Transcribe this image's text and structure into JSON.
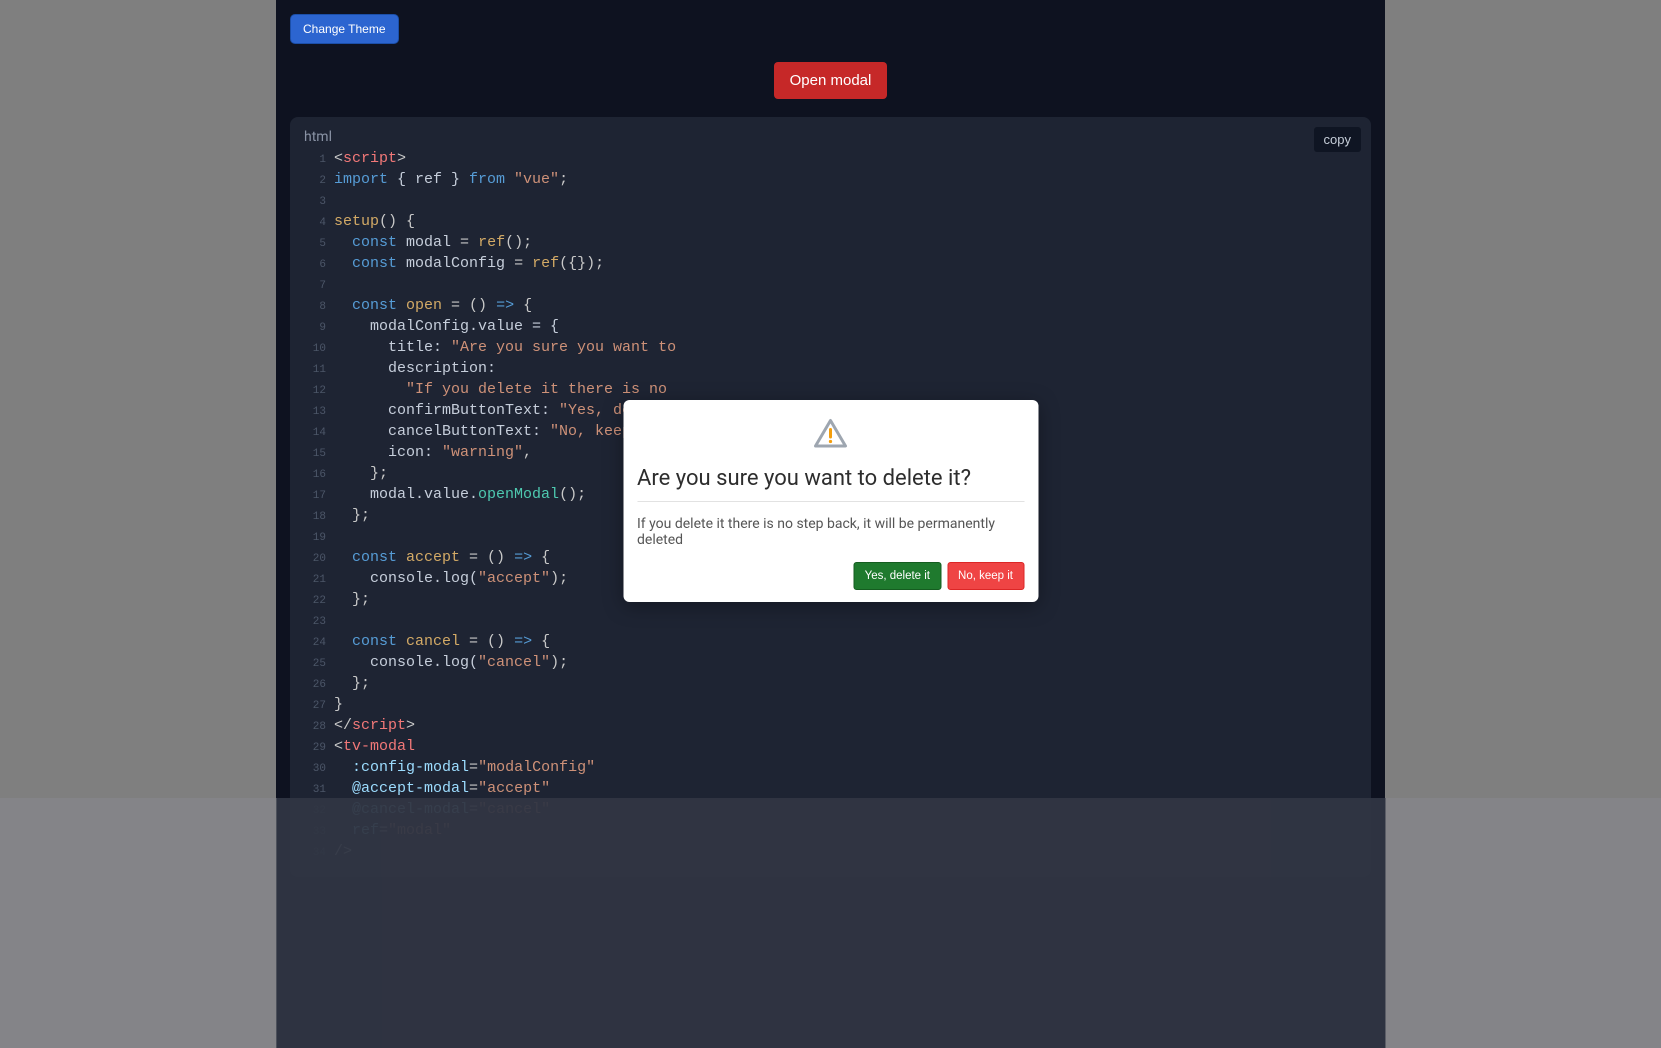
{
  "header": {
    "change_theme": "Change Theme",
    "open_modal": "Open modal"
  },
  "code": {
    "language": "html",
    "copy": "copy"
  },
  "modal": {
    "title": "Are you sure you want to delete it?",
    "description": "If you delete it there is no step back, it will be permanently deleted",
    "confirm": "Yes, delete it",
    "cancel": "No, keep it"
  },
  "snippets": {
    "open_tag_lt": "<",
    "open_tag_gt": ">",
    "close_tag_lt": "</",
    "script": "script",
    "import": "import ",
    "braces_ref": "{ ref } ",
    "from": "from ",
    "vue": "\"vue\"",
    "semi": ";",
    "setup": "setup",
    "paren_brace": "() {",
    "const_sp": "const ",
    "modal": "modal",
    "eq": " = ",
    "ref": "ref",
    "paren_empty": "();",
    "modalConfig": "modalConfig",
    "ref_obj": "({});",
    "open": "open",
    "arrow": " = () ",
    "fat": "=>",
    "brace": " {",
    "mc_val": "modalConfig.value = {",
    "title_k": "title: ",
    "title_v": "\"Are you sure you want to",
    "desc_k": "description:",
    "desc_v": "\"If you delete it there is no",
    "cbt_k": "confirmButtonText: ",
    "cbt_v": "\"Yes, delete",
    "cnt_k": "cancelButtonText: ",
    "cnt_v": "\"No, keep it\"",
    "comma": ",",
    "icon_k": "icon: ",
    "icon_v": "\"warning\"",
    "close_obj": "};",
    "modal_value": "modal.value.",
    "openModal": "openModal",
    "call_empty": "();",
    "accept": "accept",
    "console": "console",
    "dot_log": ".log(",
    "accept_str": "\"accept\"",
    "close_call": ");",
    "cancel": "cancel",
    "cancel_str": "\"cancel\"",
    "brace_close": "}",
    "tv_modal": "tv-modal",
    "attr_config": ":config-modal",
    "eq_q": "=",
    "val_modalConfig": "\"modalConfig\"",
    "attr_accept": "@accept-modal",
    "val_accept": "\"accept\"",
    "attr_cancel": "@cancel-modal",
    "val_cancel": "\"cancel\"",
    "attr_ref": "ref",
    "val_modal": "\"modal\"",
    "self_close": "/>",
    "ln": {
      "1": "1",
      "2": "2",
      "3": "3",
      "4": "4",
      "5": "5",
      "6": "6",
      "7": "7",
      "8": "8",
      "9": "9",
      "10": "10",
      "11": "11",
      "12": "12",
      "13": "13",
      "14": "14",
      "15": "15",
      "16": "16",
      "17": "17",
      "18": "18",
      "19": "19",
      "20": "20",
      "21": "21",
      "22": "22",
      "23": "23",
      "24": "24",
      "25": "25",
      "26": "26",
      "27": "27",
      "28": "28",
      "29": "29",
      "30": "30",
      "31": "31",
      "32": "32",
      "33": "33",
      "34": "34"
    }
  }
}
